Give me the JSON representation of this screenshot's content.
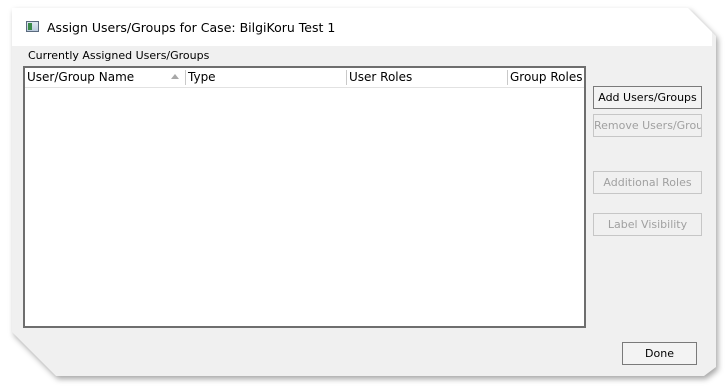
{
  "window": {
    "title": "Assign Users/Groups for Case: BilgiKoru Test 1"
  },
  "assigned_group": {
    "label": "Currently Assigned Users/Groups",
    "columns": [
      {
        "label": "User/Group Name",
        "sorted": "ascending"
      },
      {
        "label": "Type"
      },
      {
        "label": "User Roles"
      },
      {
        "label": "Group Roles"
      }
    ],
    "rows": []
  },
  "buttons": {
    "add": {
      "label": "Add Users/Groups",
      "enabled": true
    },
    "remove": {
      "label": "Remove Users/Groups",
      "enabled": false
    },
    "additional_roles": {
      "label": "Additional Roles",
      "enabled": false
    },
    "label_visibility": {
      "label": "Label Visibility",
      "enabled": false
    },
    "done": {
      "label": "Done",
      "enabled": true
    }
  },
  "colors": {
    "dialog_background": "#f0f0f0",
    "disabled_text": "#a0a0a0"
  }
}
